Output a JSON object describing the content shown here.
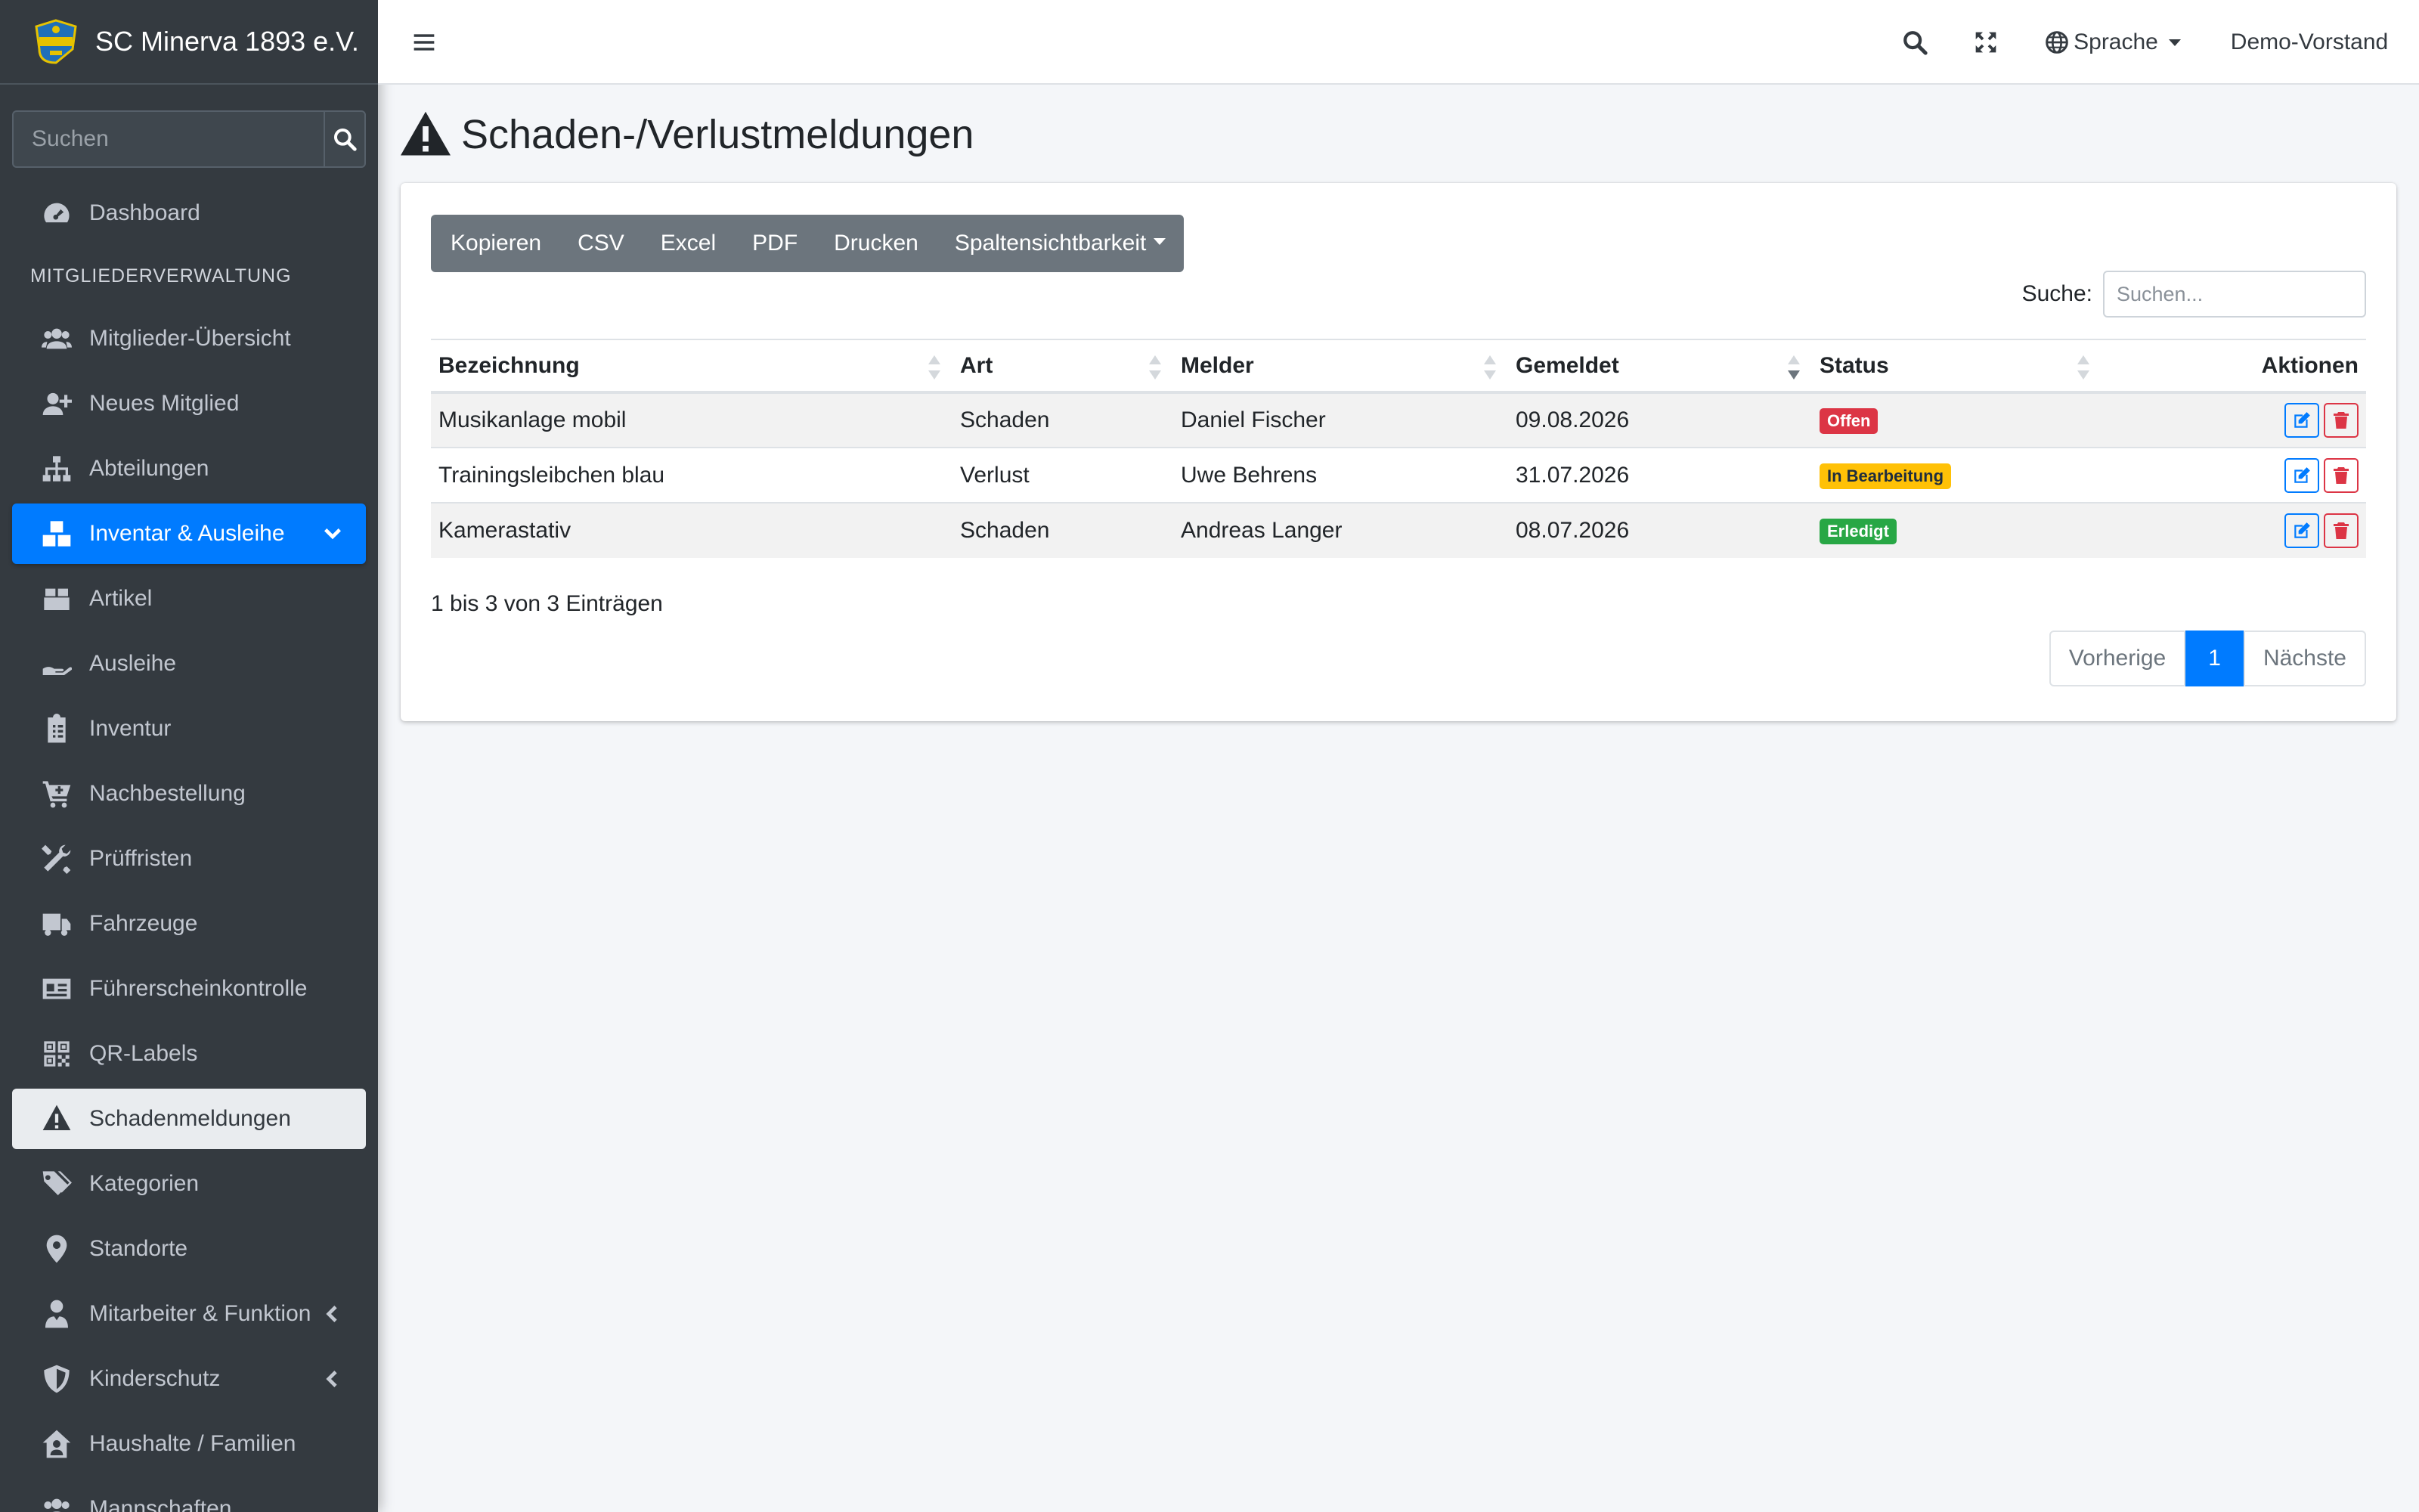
{
  "brand": {
    "title": "SC Minerva 1893 e.V."
  },
  "sidebar": {
    "search_placeholder": "Suchen",
    "section_header": "MITGLIEDERVERWALTUNG",
    "items": [
      {
        "label": "Dashboard",
        "icon": "dashboard-icon"
      },
      {
        "label": "Mitglieder-Übersicht",
        "icon": "users-icon"
      },
      {
        "label": "Neues Mitglied",
        "icon": "user-plus-icon"
      },
      {
        "label": "Abteilungen",
        "icon": "sitemap-icon"
      },
      {
        "label": "Inventar & Ausleihe",
        "icon": "boxes-icon"
      },
      {
        "label": "Artikel",
        "icon": "box-icon"
      },
      {
        "label": "Ausleihe",
        "icon": "hand-holding-icon"
      },
      {
        "label": "Inventur",
        "icon": "clipboard-list-icon"
      },
      {
        "label": "Nachbestellung",
        "icon": "cart-icon"
      },
      {
        "label": "Prüffristen",
        "icon": "tools-icon"
      },
      {
        "label": "Fahrzeuge",
        "icon": "truck-icon"
      },
      {
        "label": "Führerscheinkontrolle",
        "icon": "id-card-icon"
      },
      {
        "label": "QR-Labels",
        "icon": "qrcode-icon"
      },
      {
        "label": "Schadenmeldungen",
        "icon": "warning-icon"
      },
      {
        "label": "Kategorien",
        "icon": "tags-icon"
      },
      {
        "label": "Standorte",
        "icon": "map-marker-icon"
      },
      {
        "label": "Mitarbeiter & Funktion",
        "icon": "user-tie-icon"
      },
      {
        "label": "Kinderschutz",
        "icon": "shield-icon"
      },
      {
        "label": "Haushalte / Familien",
        "icon": "house-user-icon"
      },
      {
        "label": "Mannschaften",
        "icon": "users-icon"
      }
    ]
  },
  "topbar": {
    "language": "Sprache",
    "user": "Demo-Vorstand"
  },
  "page": {
    "title": "Schaden-/Verlustmeldungen"
  },
  "toolbar": {
    "buttons": [
      "Kopieren",
      "CSV",
      "Excel",
      "PDF",
      "Drucken",
      "Spaltensichtbarkeit"
    ]
  },
  "search": {
    "label": "Suche:",
    "placeholder": "Suchen..."
  },
  "table": {
    "headers": [
      "Bezeichnung",
      "Art",
      "Melder",
      "Gemeldet",
      "Status",
      "Aktionen"
    ],
    "rows": [
      {
        "bezeichnung": "Musikanlage mobil",
        "art": "Schaden",
        "melder": "Daniel Fischer",
        "gemeldet": "09.08.2026",
        "status": "Offen",
        "status_color": "#dc3545"
      },
      {
        "bezeichnung": "Trainingsleibchen blau",
        "art": "Verlust",
        "melder": "Uwe Behrens",
        "gemeldet": "31.07.2026",
        "status": "In Bearbeitung",
        "status_color": "#ffc107"
      },
      {
        "bezeichnung": "Kamerastativ",
        "art": "Schaden",
        "melder": "Andreas Langer",
        "gemeldet": "08.07.2026",
        "status": "Erledigt",
        "status_color": "#28a745"
      }
    ]
  },
  "info": "1 bis 3 von 3 Einträgen",
  "pagination": {
    "prev": "Vorherige",
    "current": "1",
    "next": "Nächste"
  },
  "colors": {
    "primary": "#007bff",
    "sidebar": "#343a40",
    "danger": "#dc3545"
  }
}
